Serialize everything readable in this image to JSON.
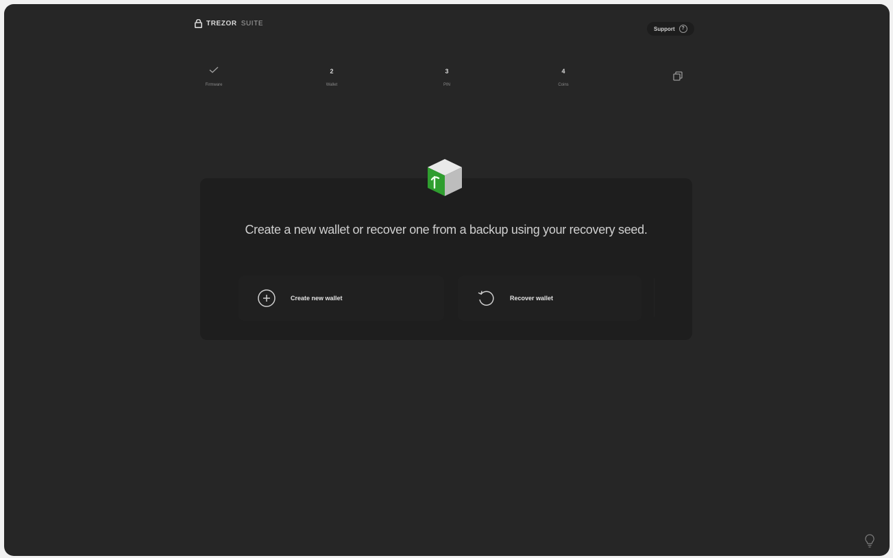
{
  "header": {
    "brand": "TREZOR",
    "product": "SUITE",
    "support_label": "Support",
    "support_icon": "question-icon"
  },
  "steps": [
    {
      "num": "",
      "label": "Firmware",
      "state": "done",
      "icon": "check-icon"
    },
    {
      "num": "2",
      "label": "Wallet",
      "state": "active"
    },
    {
      "num": "3",
      "label": "PIN",
      "state": "pending"
    },
    {
      "num": "4",
      "label": "Coins",
      "state": "pending"
    }
  ],
  "steps_end_icon": "cards-icon",
  "card": {
    "hero_icon": "wallet-cube-icon",
    "description": "Create a new wallet or recover one from a backup using your recovery seed.",
    "options": [
      {
        "label": "Create new wallet",
        "icon": "plus-circle-icon"
      },
      {
        "label": "Recover wallet",
        "icon": "recover-arrow-icon"
      }
    ]
  },
  "colors": {
    "background": "#262626",
    "card": "#1e1e1e",
    "accent_green": "#2f9e2f"
  },
  "footer": {
    "help_icon": "lightbulb-icon"
  }
}
